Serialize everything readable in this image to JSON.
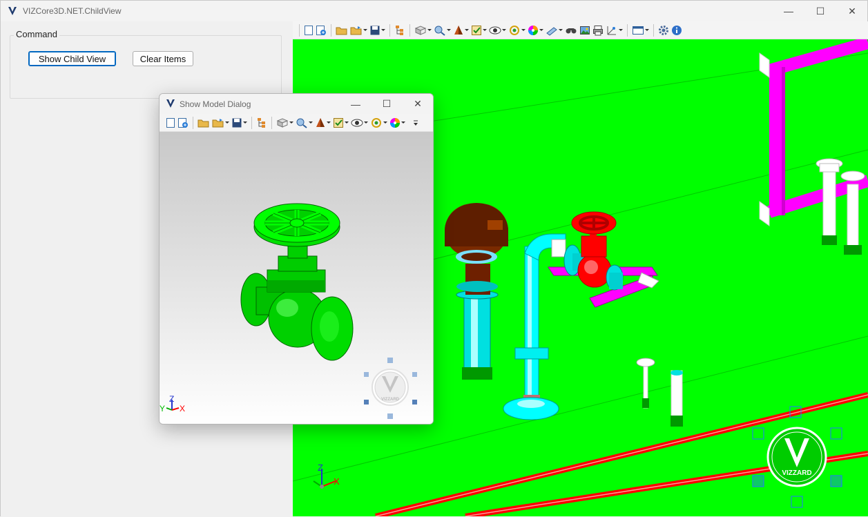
{
  "main_window": {
    "title": "VIZCore3D.NET.ChildView",
    "minimize_glyph": "—",
    "maximize_glyph": "☐",
    "close_glyph": "✕"
  },
  "command_group": {
    "legend": "Command",
    "show_child_view_label": "Show Child View",
    "clear_items_label": "Clear Items"
  },
  "dialog": {
    "title": "Show Model Dialog",
    "minimize_glyph": "—",
    "maximize_glyph": "☐",
    "close_glyph": "✕"
  },
  "axis_labels": {
    "x": "X",
    "y": "Y",
    "z": "Z"
  },
  "nav_cube": {
    "logo_text": "VIZZARD"
  },
  "colors": {
    "viewport_bg": "#00ff00",
    "pipe_magenta": "#ff00ff",
    "pipe_cyan": "#00ffff",
    "valve_red": "#ff0000",
    "valve_green": "#00dd00",
    "brown": "#7a2a00",
    "accent_blue": "#0067c0"
  },
  "toolbar_icons": [
    "new-icon",
    "new-window-icon",
    "open-icon",
    "open-multi-icon",
    "save-icon",
    "tree-icon",
    "view-direction-icon",
    "zoom-icon",
    "render-mode-icon",
    "select-icon",
    "visibility-icon",
    "rotate-icon",
    "color-icon",
    "measure-icon",
    "find-icon",
    "image-icon",
    "print-icon",
    "section-icon",
    "window-icon",
    "settings-icon",
    "info-icon"
  ]
}
